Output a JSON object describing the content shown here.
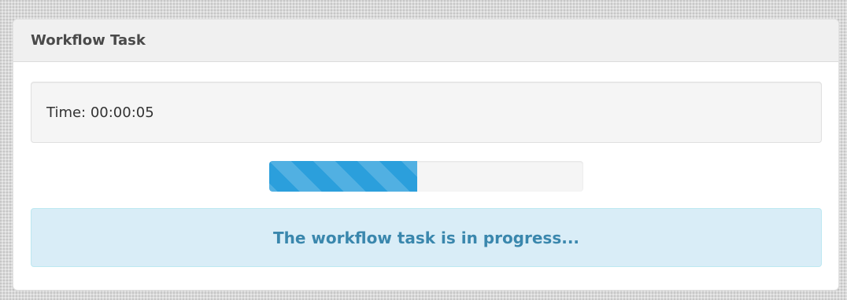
{
  "panel": {
    "title": "Workflow Task"
  },
  "timer": {
    "text": "Time: 00:00:05"
  },
  "progress": {
    "fraction": 0.47,
    "bar_color": "#2b9fdc",
    "striped": true
  },
  "alert": {
    "message": "The workflow task is in progress...",
    "background_color": "#d9edf7",
    "text_color": "#3a87ad"
  }
}
